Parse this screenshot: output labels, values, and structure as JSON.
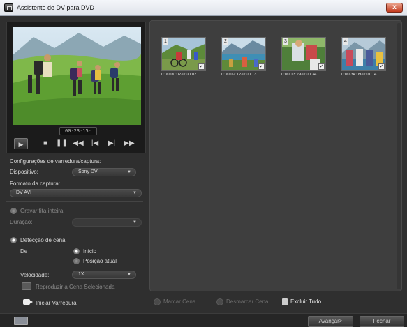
{
  "window": {
    "title": "Assistente de DV para DVD",
    "close_label": "x"
  },
  "player": {
    "timecode": "00:23:15:",
    "icons": [
      "play-icon",
      "stop-icon",
      "pause-icon",
      "rewind-icon",
      "prev-frame-icon",
      "next-frame-icon",
      "fast-forward-icon"
    ]
  },
  "settings": {
    "section_label": "Configurações de varredura/captura:",
    "device_label": "Dispositivo:",
    "device_value": "Sony DV",
    "format_label": "Formato da captura:",
    "format_value": "DV AVI",
    "record_whole_tape": "Gravar fita inteira",
    "duration_label": "Duração:",
    "duration_value": "",
    "scene_detection": "Detecção de cena",
    "from_label": "De",
    "from_start": "Início",
    "from_current": "Posição atual",
    "speed_label": "Velocidade:",
    "speed_value": "1X",
    "play_selected_scene": "Reproduzir a Cena Selecionada",
    "start_scan": "Iniciar Varredura"
  },
  "scenes": [
    {
      "number": "1",
      "range": "0:00:00:02-0:00:02..."
    },
    {
      "number": "2",
      "range": "0:00:02:12-0:00:13..."
    },
    {
      "number": "3",
      "range": "0:00:13:29-0:00:34..."
    },
    {
      "number": "4",
      "range": "0:00:34:09-0:01:14..."
    }
  ],
  "actions": {
    "mark_scene": "Marcar Cena",
    "unmark_scene": "Desmarcar Cena",
    "delete_all": "Excluir Tudo"
  },
  "footer": {
    "next": "Avançar>",
    "close": "Fechar"
  }
}
